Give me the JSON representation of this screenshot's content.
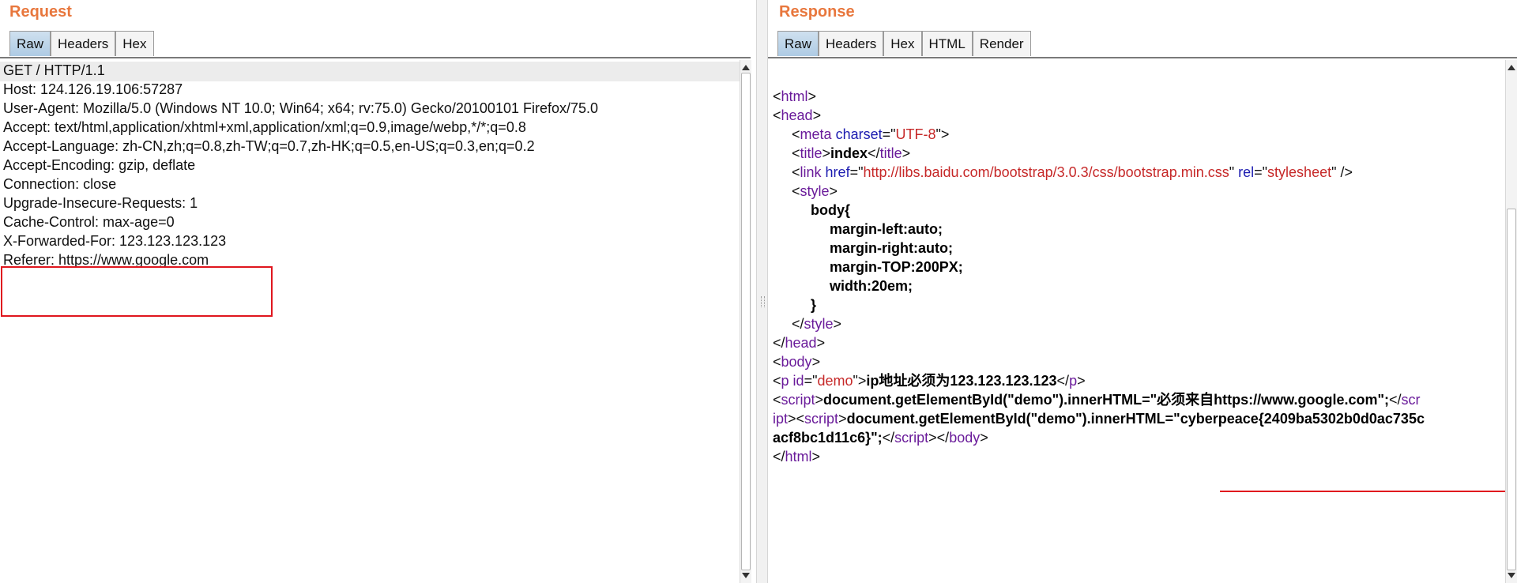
{
  "request": {
    "title": "Request",
    "tabs": [
      "Raw",
      "Headers",
      "Hex"
    ],
    "active_tab": "Raw",
    "lines": [
      "GET / HTTP/1.1",
      "Host: 124.126.19.106:57287",
      "User-Agent: Mozilla/5.0 (Windows NT 10.0; Win64; x64; rv:75.0) Gecko/20100101 Firefox/75.0",
      "Accept: text/html,application/xhtml+xml,application/xml;q=0.9,image/webp,*/*;q=0.8",
      "Accept-Language: zh-CN,zh;q=0.8,zh-TW;q=0.7,zh-HK;q=0.5,en-US;q=0.3,en;q=0.2",
      "Accept-Encoding: gzip, deflate",
      "Connection: close",
      "Upgrade-Insecure-Requests: 1",
      "Cache-Control: max-age=0",
      "X-Forwarded-For: 123.123.123.123",
      "Referer: https://www.google.com"
    ]
  },
  "response": {
    "title": "Response",
    "tabs": [
      "Raw",
      "Headers",
      "Hex",
      "HTML",
      "Render"
    ],
    "active_tab": "Raw",
    "html": {
      "html_tag": "html",
      "head_tag": "head",
      "meta_tag": "meta",
      "meta_attr": "charset",
      "meta_val": "UTF-8",
      "title_tag": "title",
      "title_text": "index",
      "link_tag": "link",
      "link_href_attr": "href",
      "link_href": "http://libs.baidu.com/bootstrap/3.0.3/css/bootstrap.min.css",
      "link_rel_attr": "rel",
      "link_rel": "stylesheet",
      "style_tag": "style",
      "css_selector": "body{",
      "css_lines": [
        "margin-left:auto;",
        "margin-right:auto;",
        "margin-TOP:200PX;",
        "width:20em;"
      ],
      "css_close": "}",
      "body_tag": "body",
      "p_tag": "p",
      "p_id_attr": "id",
      "p_id": "demo",
      "p_text": "ip地址必须为123.123.123.123",
      "script_tag": "script",
      "script1_code": "document.getElementById(\"demo\").innerHTML=\"必须来自https://www.google.com\";",
      "script_split_a": "scr",
      "script_split_b": "ipt",
      "script2_code_a": "document.getElementById(\"demo\").innerHTML=\"",
      "flag_a": "cyberpeace{2409ba5302b0d0ac735c",
      "flag_b": "acf8bc1d11c6}",
      "script2_code_b": "\";"
    }
  },
  "colors": {
    "title": "#e8773d",
    "highlight_box": "#e0161e",
    "tag": "#6a1b9a",
    "attr": "#1b1bb0",
    "value": "#c62828"
  }
}
